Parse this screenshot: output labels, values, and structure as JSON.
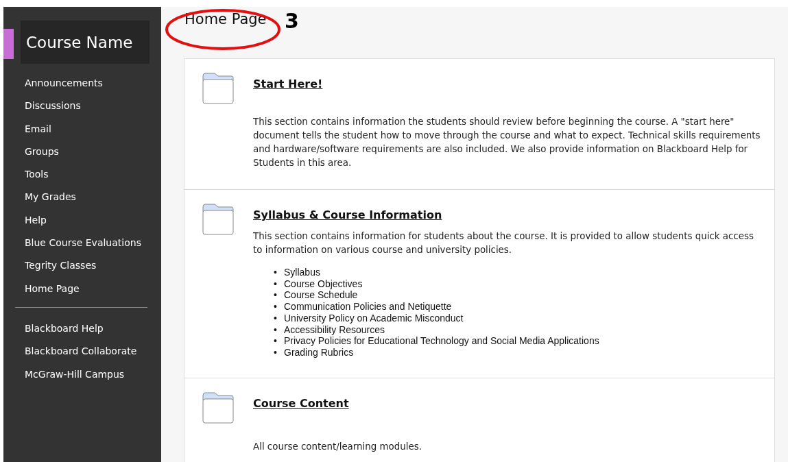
{
  "sidebar": {
    "course_name": "Course Name",
    "items": [
      "Announcements",
      "Discussions",
      "Email",
      "Groups",
      "Tools",
      "My Grades",
      "Help",
      "Blue Course Evaluations",
      "Tegrity Classes",
      "Home Page"
    ],
    "links": [
      "Blackboard Help",
      "Blackboard Collaborate",
      "McGraw-Hill Campus"
    ]
  },
  "page_title": "Home Page",
  "annotation": {
    "number": "3"
  },
  "sections": [
    {
      "title": "Start Here!",
      "description": "This section contains information the students should review before beginning the course. A \"start here\" document tells the student how to move through the course and what to expect. Technical skills requirements and hardware/software requirements are also included. We also provide information on Blackboard Help for Students in this area."
    },
    {
      "title": "Syllabus & Course Information",
      "description": "This section contains information for students about the course. It is provided to allow students quick access to information on various course and university policies.",
      "bullet": "•",
      "bullets": [
        "Syllabus",
        "Course Objectives",
        "Course Schedule",
        "Communication Policies and Netiquette",
        "University Policy on Academic Misconduct",
        "Accessibility Resources",
        "Privacy Policies for Educational Technology and Social Media Applications",
        "Grading Rubrics"
      ]
    },
    {
      "title": "Course Content",
      "description": "All course content/learning modules."
    }
  ]
}
